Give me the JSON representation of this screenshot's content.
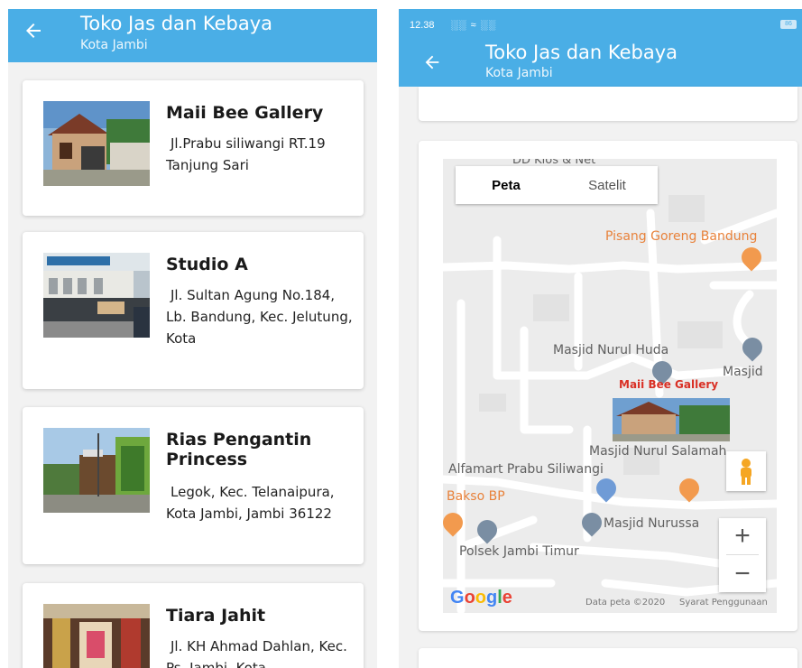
{
  "left_screen": {
    "app_title": "Toko Jas dan Kebaya",
    "app_subtitle": "Kota Jambi",
    "stores": [
      {
        "name": "Maii Bee Gallery",
        "address": "Jl.Prabu siliwangi RT.19 Tanjung Sari"
      },
      {
        "name": "Studio A",
        "address": "Jl. Sultan Agung No.184, Lb. Bandung, Kec. Jelutung, Kota"
      },
      {
        "name": "Rias Pengantin Princess",
        "address": "Legok, Kec. Telanaipura, Kota Jambi, Jambi 36122"
      },
      {
        "name": "Tiara Jahit",
        "address": "Jl. KH Ahmad Dahlan, Kec. Ps. Jambi, Kota"
      }
    ]
  },
  "right_screen": {
    "status_time": "12.38",
    "status_signal": "░░ ≈ ░░",
    "status_battery": "86",
    "app_title": "Toko Jas dan Kebaya",
    "app_subtitle": "Kota Jambi",
    "map": {
      "type_tabs": [
        "Peta",
        "Satelit"
      ],
      "active_tab": "Peta",
      "labels": {
        "top_cut": "DD Kios & Net",
        "pisang": "Pisang Goreng Bandung",
        "nurul_huda": "Masjid Nurul Huda",
        "masjid": "Masjid",
        "marker": "Maii Bee Gallery",
        "nurul_salamah": "Masjid Nurul Salamah",
        "alfamart": "Alfamart Prabu Siliwangi",
        "bakso": "Bakso BP",
        "nurussa": "Masjid Nurussa",
        "polsek": "Polsek Jambi Timur",
        "data_peta": "Data peta ©2020",
        "syarat": "Syarat Penggunaan"
      },
      "google_logo": [
        "G",
        "o",
        "o",
        "g",
        "l",
        "e"
      ],
      "zoom_in": "+",
      "zoom_out": "−"
    }
  },
  "colors": {
    "appbar": "#4aaee6",
    "map_bg": "#ececec"
  }
}
